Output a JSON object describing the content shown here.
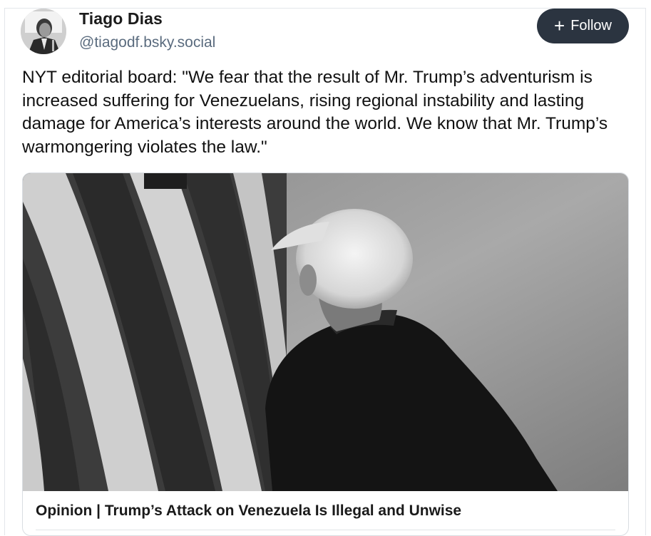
{
  "author": {
    "name": "Tiago Dias",
    "handle": "@tiagodf.bsky.social"
  },
  "follow_button": {
    "icon": "plus-icon",
    "label": "Follow"
  },
  "post": {
    "text": "NYT editorial board: \"We fear that the result of Mr. Trump’s adventurism is increased suffering for Venezuelans, rising regional instability and lasting damage for America’s interests around the world. We know that Mr. Trump’s warmongering violates the law.\""
  },
  "embed": {
    "title": "Opinion | Trump’s Attack on Venezuela Is Illegal and Unwise"
  },
  "colors": {
    "follow_bg": "#2b3440",
    "handle": "#5a6b7e"
  }
}
